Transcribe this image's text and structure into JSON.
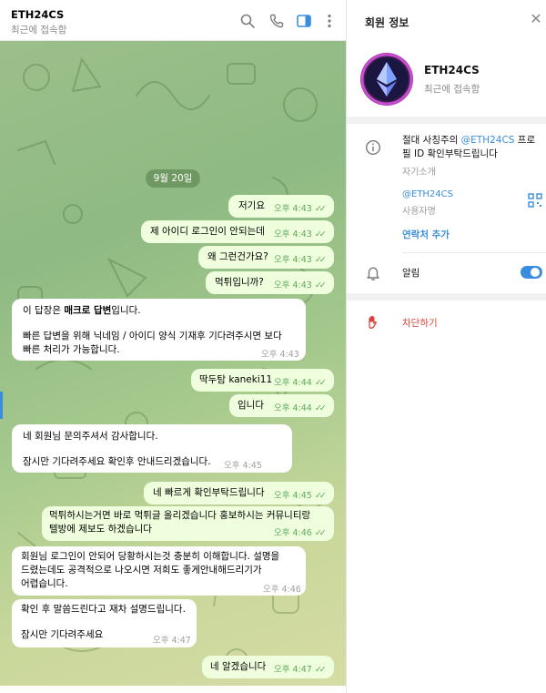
{
  "chat": {
    "title": "ETH24CS",
    "status": "최근에 접속함",
    "date_label": "9월 20일",
    "messages": [
      {
        "text": "저기요",
        "time": "오후 4:43"
      },
      {
        "text": "제 아이디 로그인이 안되는데",
        "time": "오후 4:43"
      },
      {
        "text": "왜 그런건가요?",
        "time": "오후 4:43"
      },
      {
        "text": "먹튀입니까?",
        "time": "오후 4:43"
      },
      {
        "line1_a": "이 답장은 ",
        "line1_b": "매크로 답변",
        "line1_c": "입니다.",
        "line2": "빠른 답변을 위해 닉네임 / 아이디 양식 기재후 기다려주시면 보다",
        "line3": "빠른 처리가 가능합니다.",
        "time": "오후 4:43"
      },
      {
        "text": "딱두탐 kaneki11",
        "time": "오후 4:44"
      },
      {
        "text": "입니다",
        "time": "오후 4:44"
      },
      {
        "line1": "네 회원님 문의주셔서 감사합니다.",
        "line2": "잠시만 기다려주세요 확인후 안내드리겠습니다.",
        "time": "오후 4:45"
      },
      {
        "text": "네 빠르게 확인부탁드립니다",
        "time": "오후 4:45"
      },
      {
        "line1": "먹튀하시는거면 바로 먹튀글 올리겠습니다 홍보하시는 커뮤니티랑",
        "line2": "텔방에 제보도 하겠습니다",
        "time": "오후 4:46"
      },
      {
        "line1": "회원님 로그인이 안되어 당황하시는것 충분히 이해합니다. 설명을",
        "line2": "드렸는데도 공격적으로 나오시면 저희도 좋게안내해드리기가",
        "line3": "어렵습니다.",
        "time": "오후 4:46"
      },
      {
        "line1": "확인 후 말씀드린다고 재차 설명드립니다.",
        "line2": "잠시만 기다려주세요",
        "time": "오후 4:47"
      },
      {
        "text": "네 알겠습니다",
        "time": "오후 4:47"
      }
    ]
  },
  "panel": {
    "title": "회원 정보",
    "name": "ETH24CS",
    "status": "최근에 접속함",
    "bio_prefix": "절대 사칭주의 ",
    "bio_link": "@ETH24CS",
    "bio_suffix": " 프로필 ID 확인부탁드립니다",
    "bio_label": "자기소개",
    "username": "@ETH24CS",
    "username_label": "사용자명",
    "add_contact": "연락처 추가",
    "notifications": "알림",
    "notifications_on": true,
    "block": "차단하기"
  },
  "colors": {
    "accent": "#3a8dde",
    "outgoing_bubble": "#effedd",
    "incoming_bubble": "#ffffff",
    "danger": "#d9453d",
    "time_outgoing": "#5fa95a"
  },
  "icons": [
    "search-icon",
    "phone-icon",
    "sidebar-toggle-icon",
    "more-vertical-icon",
    "close-icon",
    "info-icon",
    "qr-code-icon",
    "bell-icon",
    "block-hand-icon",
    "double-check-icon"
  ]
}
